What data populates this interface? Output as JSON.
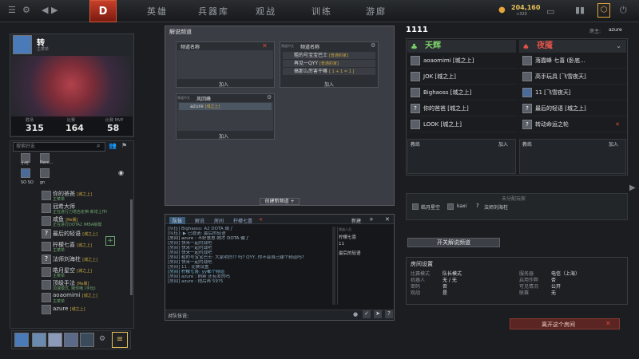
{
  "topbar": {
    "logo": "D",
    "nav": [
      "英雄",
      "兵器库",
      "观战",
      "训练",
      "游廊"
    ],
    "gold": "204,160",
    "gold_sub": "+320"
  },
  "profile": {
    "name": "转",
    "subtitle": "主菜单",
    "stats": [
      {
        "value": "315",
        "label": "胜场"
      },
      {
        "value": "164",
        "label": "比赛"
      },
      {
        "value": "58",
        "label": "比赛 MVP"
      }
    ]
  },
  "friends": {
    "search_placeholder": "搜索好友",
    "top_names": [
      "小可",
      "Narc...",
      "SO SO",
      "gn"
    ],
    "items": [
      {
        "name": "你的爸爸",
        "tag": "[城之上]",
        "sub": "主菜单"
      },
      {
        "name": "冠希大师",
        "tag": "",
        "sub": "正在进行刀塔自走棋-新增上传!"
      },
      {
        "name": "咸鱼",
        "tag": "[Re版]",
        "sub": "正在进行DOTA2 IMBA版模"
      },
      {
        "name": "最后的轻语",
        "tag": "[城之上]",
        "sub": ""
      },
      {
        "name": "柠檬七喜",
        "tag": "[城之上]",
        "sub": "主菜单"
      },
      {
        "name": "法师刘海柱",
        "tag": "[城之上]",
        "sub": ""
      },
      {
        "name": "皓月星空",
        "tag": "[城之上]",
        "sub": "主菜单"
      },
      {
        "name": "顶级手法",
        "tag": "[Re版]",
        "sub": "加速模式, 赌你哦 (手玩)"
      },
      {
        "name": "aoaomimi",
        "tag": "[城之上]",
        "sub": "主菜单"
      },
      {
        "name": "azure",
        "tag": "[城之上]",
        "sub": ""
      }
    ]
  },
  "center": {
    "title": "解说频道",
    "box1": {
      "title": "频道名称",
      "join": "加入"
    },
    "box2": {
      "badge": "频道中文",
      "title": "频道名称",
      "rows": [
        "粗的号宝宝巴士",
        "再见一QYY",
        "搞那么厉害干嘛"
      ],
      "tags": [
        "[普通的家]",
        "[普通的家]",
        "[ 1 + 1 = 1 ]"
      ],
      "join": "加入"
    },
    "box3": {
      "badge": "频道中文",
      "title": "风回峰",
      "rows": [
        "azure"
      ],
      "tags": [
        "[城之上]"
      ],
      "join": "加入"
    },
    "create_button": "创建新频道 +"
  },
  "chat": {
    "tabs": [
      "队伍",
      "解说",
      "房间",
      "柠檬七喜"
    ],
    "add": "新建",
    "lines": [
      "[队伍] Bighaoss: A2 DOTA 输了",
      "[队伍]: ▶ 已邀请: 最后的轻语",
      "[房间] azure : 不好意思 刚才 DOTA 输了",
      "[房间] 快来一起约战吧",
      "[房间] 快来一起约战吧",
      "[房间] 快来一起约战吧",
      "[房间] 粗的号宝宝巴士: 大家明白!? 吗? QYY, 你不会自己建个频道吗?",
      "[房间] 快来一起约战吧",
      "[房间] 11 : 比赛设置",
      "[房间] 柠檬七喜: yy都个频道",
      "[房间] azure : 刷新 还有发的吗",
      "[房间] azure : 稍后再 59?5"
    ],
    "members": [
      "柠檬七喜",
      "11",
      "最后的轻语"
    ],
    "member_header": "频道人员",
    "input_label": "对队伍说:"
  },
  "room": {
    "id": "1111",
    "host_label": "房主: ",
    "host": "azure",
    "radiant": {
      "name": "天辉",
      "players": [
        "aoaomimi [城之上]",
        "JOK [城之上]",
        "Bighaoss [城之上]",
        "你的爸爸 [城之上]",
        "LOOK [城之上]"
      ],
      "coach": "教练",
      "join": "加入"
    },
    "dire": {
      "name": "夜魇",
      "players": [
        "落霞峰 七喜 (卧底...",
        "高手玩具 [飞雪夜天]",
        "11 [飞雪夜天]",
        "最后的轻语 [城之上]",
        "转动命运之轮"
      ],
      "coach": "教练",
      "join": "加入"
    },
    "unassigned_title": "未分配玩家",
    "unassigned": [
      "皓月星空",
      "kaxi",
      "法师刘海柱"
    ],
    "broadcast_button": "开关解说频道",
    "settings_title": "房间设置",
    "settings_left": [
      [
        "比赛模式",
        "队长模式"
      ],
      [
        "机器人",
        "无 / 无"
      ],
      [
        "密码",
        "否"
      ],
      [
        "观战",
        "是"
      ]
    ],
    "settings_right": [
      [
        "服务器",
        "电信（上海）"
      ],
      [
        "启用作弊",
        "否"
      ],
      [
        "可见情况",
        "公开"
      ],
      [
        "联赛",
        "无"
      ]
    ],
    "leave_button": "离开这个房间"
  },
  "colors": {
    "accent": "#e8c15a",
    "radiant": "#7cd36b",
    "dire": "#e0534a",
    "bg": "#1b1d20"
  }
}
